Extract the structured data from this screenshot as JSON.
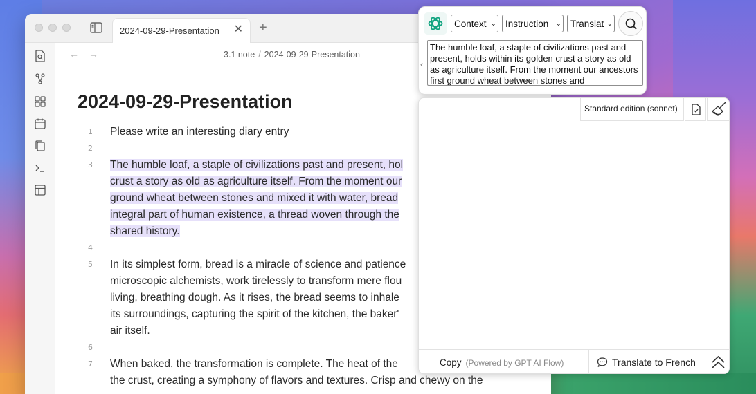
{
  "editor": {
    "tab_title": "2024-09-29-Presentation",
    "tab_close": "✕",
    "new_tab": "+",
    "nav_back": "←",
    "nav_forward": "→",
    "breadcrumb": [
      "3.1 note",
      "2024-09-29-Presentation"
    ],
    "breadcrumb_sep": "/",
    "title": "2024-09-29-Presentation",
    "lines": [
      {
        "num": "1",
        "text": [
          "Please write an interesting diary entry"
        ]
      },
      {
        "num": "2",
        "text": []
      },
      {
        "num": "3",
        "text": [
          "The humble loaf, a staple of civilizations past and present, hol",
          "crust a story as old as agriculture itself. From the moment our",
          "ground wheat between stones and mixed it with water, bread",
          "integral part of human existence, a thread woven through the",
          "shared history."
        ]
      },
      {
        "num": "4",
        "text": []
      },
      {
        "num": "5",
        "text": [
          "In its simplest form, bread is a miracle of science and patience",
          "microscopic alchemists, work tirelessly to transform mere flou",
          "living, breathing dough. As it rises, the bread seems to inhale",
          "its surroundings, capturing the spirit of the kitchen, the baker'",
          "air itself."
        ]
      },
      {
        "num": "6",
        "text": []
      },
      {
        "num": "7",
        "text": [
          "When baked, the transformation is complete. The heat of the",
          "the crust, creating a symphony of flavors and textures. Crisp and chewy on the"
        ]
      }
    ]
  },
  "gpt_popup": {
    "selects": [
      "Context",
      "Instruction",
      "Translat"
    ],
    "collapse_glyph": "‹",
    "source_text": "The humble loaf, a staple of civilizations past and present, holds within its golden crust a story as old as agriculture itself. From the moment our ancestors first ground wheat between stones and"
  },
  "result_panel": {
    "model_label": "Standard edition (sonnet)",
    "copy_label": "Copy",
    "powered_by": "(Powered by GPT AI Flow)",
    "translate_label": "Translate to French"
  },
  "colors": {
    "highlight": "#e6e0fa",
    "gpt_green": "#10a37f"
  }
}
